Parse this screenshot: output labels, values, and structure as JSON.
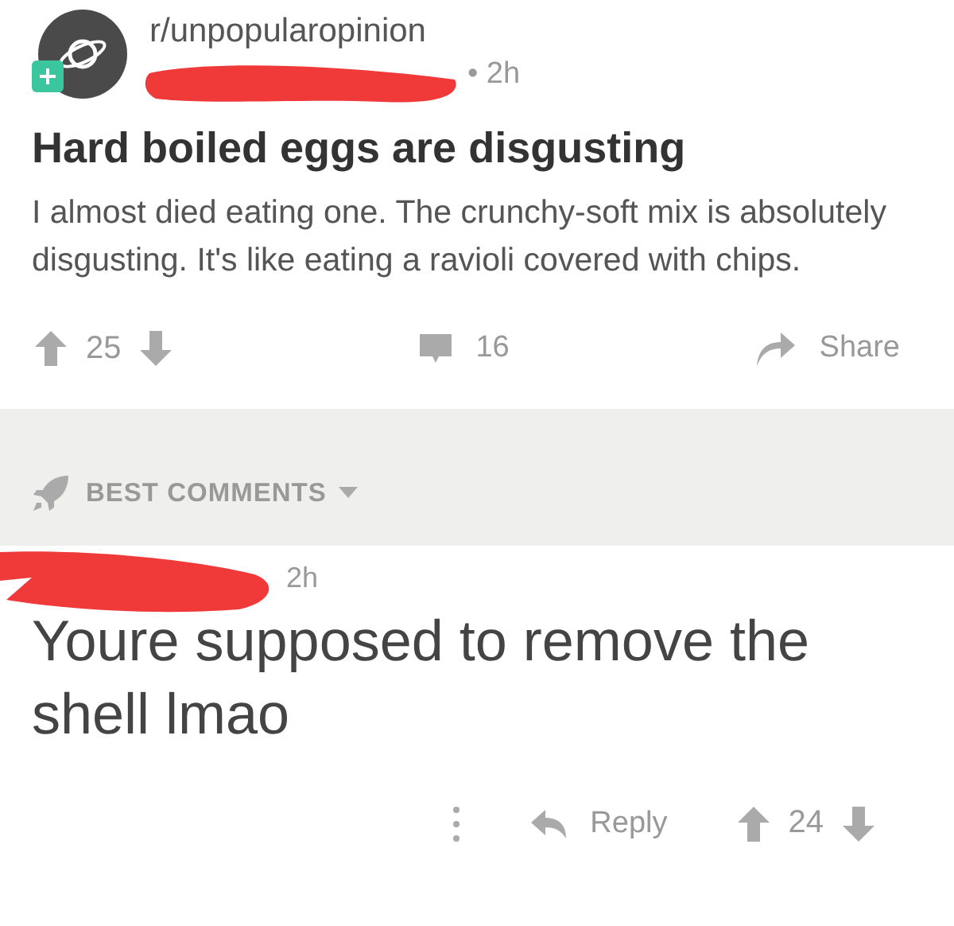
{
  "post": {
    "subreddit": "r/unpopularopinion",
    "meta": "• 2h",
    "redacted_author": true,
    "title": "Hard boiled eggs are disgusting",
    "body": "I almost died eating one. The crunchy-soft mix is absolutely disgusting. It's like eating a ravioli covered with chips.",
    "score": "25",
    "comments": "16",
    "share": "Share"
  },
  "sort": {
    "label": "BEST COMMENTS"
  },
  "comment": {
    "redacted_author": true,
    "time": "2h",
    "text": "Youre supposed to remove the shell lmao",
    "reply": "Reply",
    "score": "24"
  }
}
